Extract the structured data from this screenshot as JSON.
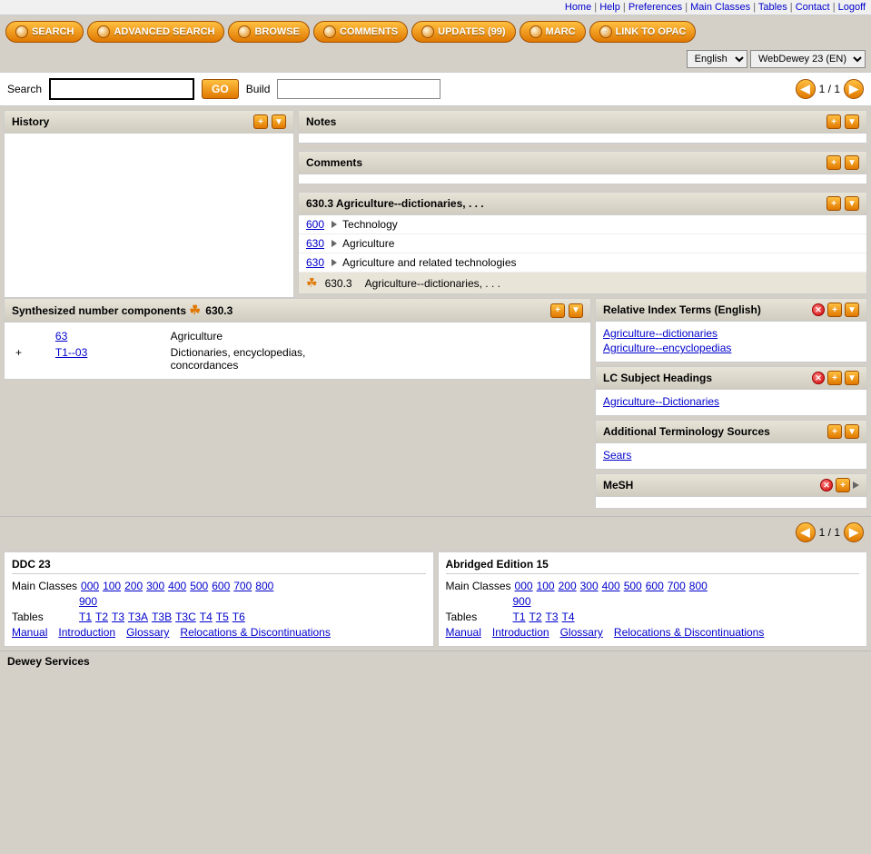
{
  "topnav": {
    "links": [
      "Home",
      "Help",
      "Preferences",
      "Main Classes",
      "Tables",
      "Contact",
      "Logoff"
    ]
  },
  "buttons": {
    "search": "SEARCH",
    "advanced_search": "ADVANCED SEARCH",
    "browse": "BROWSE",
    "comments": "COMMENTS",
    "updates": "UPDATES (99)",
    "marc": "MARC",
    "link_to_opac": "LINK TO OPAC"
  },
  "selects": {
    "language": "English",
    "edition": "WebDewey 23 (EN)"
  },
  "search": {
    "label": "Search",
    "placeholder": "",
    "go_label": "GO",
    "build_label": "Build",
    "build_placeholder": "",
    "page_current": "1",
    "page_total": "1"
  },
  "history_panel": {
    "title": "History"
  },
  "notes_panel": {
    "title": "Notes"
  },
  "comments_panel": {
    "title": "Comments"
  },
  "main_panel": {
    "title": "630.3 Agriculture--dictionaries, . . .",
    "breadcrumbs": [
      {
        "code": "600",
        "label": "Technology",
        "has_dropdown": true
      },
      {
        "code": "630",
        "label": "Agriculture",
        "has_dropdown": true
      },
      {
        "code": "630",
        "label": "Agriculture and related technologies",
        "has_dropdown": true
      },
      {
        "code": "630.3",
        "label": "Agriculture--dictionaries, . . .",
        "active": true,
        "has_puzzle": true
      }
    ]
  },
  "synthesized": {
    "title": "Synthesized number components",
    "number": "630.3",
    "rows": [
      {
        "code": "63",
        "label": "Agriculture",
        "prefix": ""
      },
      {
        "code": "T1--03",
        "label": "Dictionaries, encyclopedias, concordances",
        "prefix": "+"
      }
    ]
  },
  "relative_index": {
    "title": "Relative Index Terms (English)",
    "links": [
      "Agriculture--dictionaries",
      "Agriculture--encyclopedias"
    ]
  },
  "lc_subject": {
    "title": "LC Subject Headings",
    "links": [
      "Agriculture--Dictionaries"
    ]
  },
  "additional_terminology": {
    "title": "Additional Terminology Sources",
    "links": [
      "Sears"
    ]
  },
  "mesh": {
    "title": "MeSH"
  },
  "ddc23": {
    "title": "DDC 23",
    "main_classes_label": "Main Classes",
    "main_class_numbers": [
      "000",
      "100",
      "200",
      "300",
      "400",
      "500",
      "600",
      "700",
      "800"
    ],
    "extra_numbers": [
      "900"
    ],
    "tables_label": "Tables",
    "table_numbers": [
      "T1",
      "T2",
      "T3",
      "T3A",
      "T3B",
      "T3C",
      "T4",
      "T5",
      "T6"
    ],
    "misc_links": [
      "Manual",
      "Introduction",
      "Glossary",
      "Relocations & Discontinuations"
    ]
  },
  "abridged": {
    "title": "Abridged Edition 15",
    "main_classes_label": "Main Classes",
    "main_class_numbers": [
      "000",
      "100",
      "200",
      "300",
      "400",
      "500",
      "600",
      "700",
      "800"
    ],
    "extra_numbers": [
      "900"
    ],
    "tables_label": "Tables",
    "table_numbers": [
      "T1",
      "T2",
      "T3",
      "T4"
    ],
    "misc_links": [
      "Manual",
      "Introduction",
      "Glossary",
      "Relocations & Discontinuations"
    ]
  },
  "dewey_footer": {
    "label": "Dewey Services"
  }
}
